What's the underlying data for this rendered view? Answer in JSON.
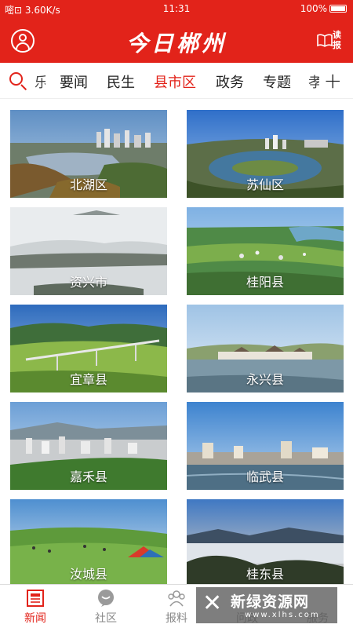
{
  "status_bar": {
    "left": "嘧⊡ 3.60K/s",
    "time": "11:31",
    "battery": "100%"
  },
  "header": {
    "logo": "今日郴州",
    "read_label": "读报",
    "accent": "#e2231a"
  },
  "tabs": {
    "items": [
      "要闻",
      "民生",
      "县市区",
      "政务",
      "专题"
    ],
    "clipped_left": "乐",
    "clipped_right": "孝",
    "active": "县市区",
    "more_label": "+"
  },
  "grid": {
    "cards": [
      {
        "label": "北湖区",
        "scene": "lake-city"
      },
      {
        "label": "苏仙区",
        "scene": "island-city"
      },
      {
        "label": "资兴市",
        "scene": "fog-mountains"
      },
      {
        "label": "桂阳县",
        "scene": "green-plain"
      },
      {
        "label": "宜章县",
        "scene": "green-valley-bridge"
      },
      {
        "label": "永兴县",
        "scene": "riverside-town"
      },
      {
        "label": "嘉禾县",
        "scene": "city-green-hill"
      },
      {
        "label": "临武县",
        "scene": "waterfront-city"
      },
      {
        "label": "汝城县",
        "scene": "meadow-tent"
      },
      {
        "label": "桂东县",
        "scene": "sea-of-clouds"
      }
    ]
  },
  "bottom_nav": {
    "items": [
      {
        "label": "新闻",
        "icon": "newspaper-icon",
        "active": true
      },
      {
        "label": "社区",
        "icon": "chat-bubble-icon",
        "active": false
      },
      {
        "label": "报料",
        "icon": "people-icon",
        "active": false
      },
      {
        "label": "问政",
        "icon": "question-icon",
        "active": false
      },
      {
        "label": "服务",
        "icon": "service-icon",
        "active": false
      }
    ]
  },
  "watermark": {
    "title": "新绿资源网",
    "subtitle": "www.xlhs.com"
  }
}
